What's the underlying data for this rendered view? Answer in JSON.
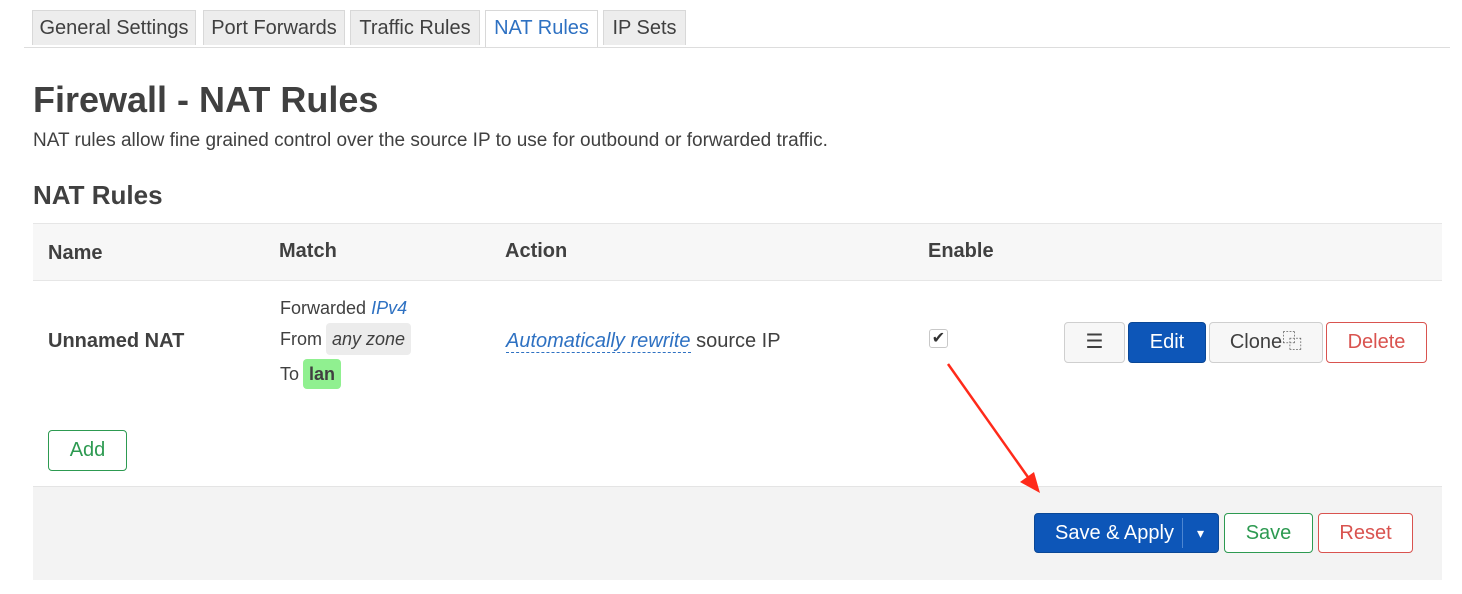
{
  "tabs": [
    {
      "label": "General Settings"
    },
    {
      "label": "Port Forwards"
    },
    {
      "label": "Traffic Rules"
    },
    {
      "label": "NAT Rules"
    },
    {
      "label": "IP Sets"
    }
  ],
  "page_title": "Firewall - NAT Rules",
  "page_description": "NAT rules allow fine grained control over the source IP to use for outbound or forwarded traffic.",
  "section_title": "NAT Rules",
  "table": {
    "headers": {
      "name": "Name",
      "match": "Match",
      "action": "Action",
      "enable": "Enable"
    },
    "rows": [
      {
        "name": "Unnamed NAT",
        "match": {
          "forwarded_label": "Forwarded",
          "family": "IPv4",
          "from_label": "From",
          "from_zone": "any zone",
          "to_label": "To",
          "to_zone": "lan"
        },
        "action": {
          "link": "Automatically rewrite",
          "rest": "source IP"
        },
        "enabled": true,
        "buttons": {
          "menu": "☰",
          "edit": "Edit",
          "clone": "Clone⿻",
          "delete": "Delete"
        }
      }
    ]
  },
  "add_button": "Add",
  "footer": {
    "save_apply": "Save & Apply",
    "dropdown": "▾",
    "save": "Save",
    "reset": "Reset"
  },
  "colors": {
    "accent": "#0d56b8",
    "link": "#2e71c2",
    "danger": "#d9534f",
    "success": "#2d9a51",
    "lan_zone": "#90f090",
    "annotation_arrow": "#ff2a1a"
  },
  "icons": {
    "checkbox": "✔",
    "menu": "hamburger-icon"
  }
}
